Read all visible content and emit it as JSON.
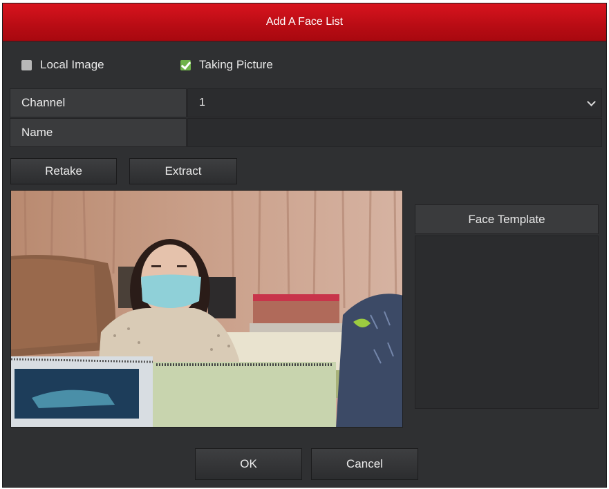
{
  "dialog": {
    "title": "Add A Face List"
  },
  "source_options": [
    {
      "label": "Local Image",
      "checked": false
    },
    {
      "label": "Taking Picture",
      "checked": true
    }
  ],
  "form": {
    "channel_label": "Channel",
    "channel_value": "1",
    "name_label": "Name",
    "name_value": ""
  },
  "actions": {
    "retake_label": "Retake",
    "extract_label": "Extract"
  },
  "face_template": {
    "header": "Face Template"
  },
  "footer": {
    "ok_label": "OK",
    "cancel_label": "Cancel"
  },
  "icons": {
    "checkbox_checked": "checkmark-icon",
    "dropdown": "chevron-down-icon"
  },
  "colors": {
    "titlebar": "#c80f18",
    "dialog_bg": "#2f3032",
    "checked": "#6fb24a"
  }
}
